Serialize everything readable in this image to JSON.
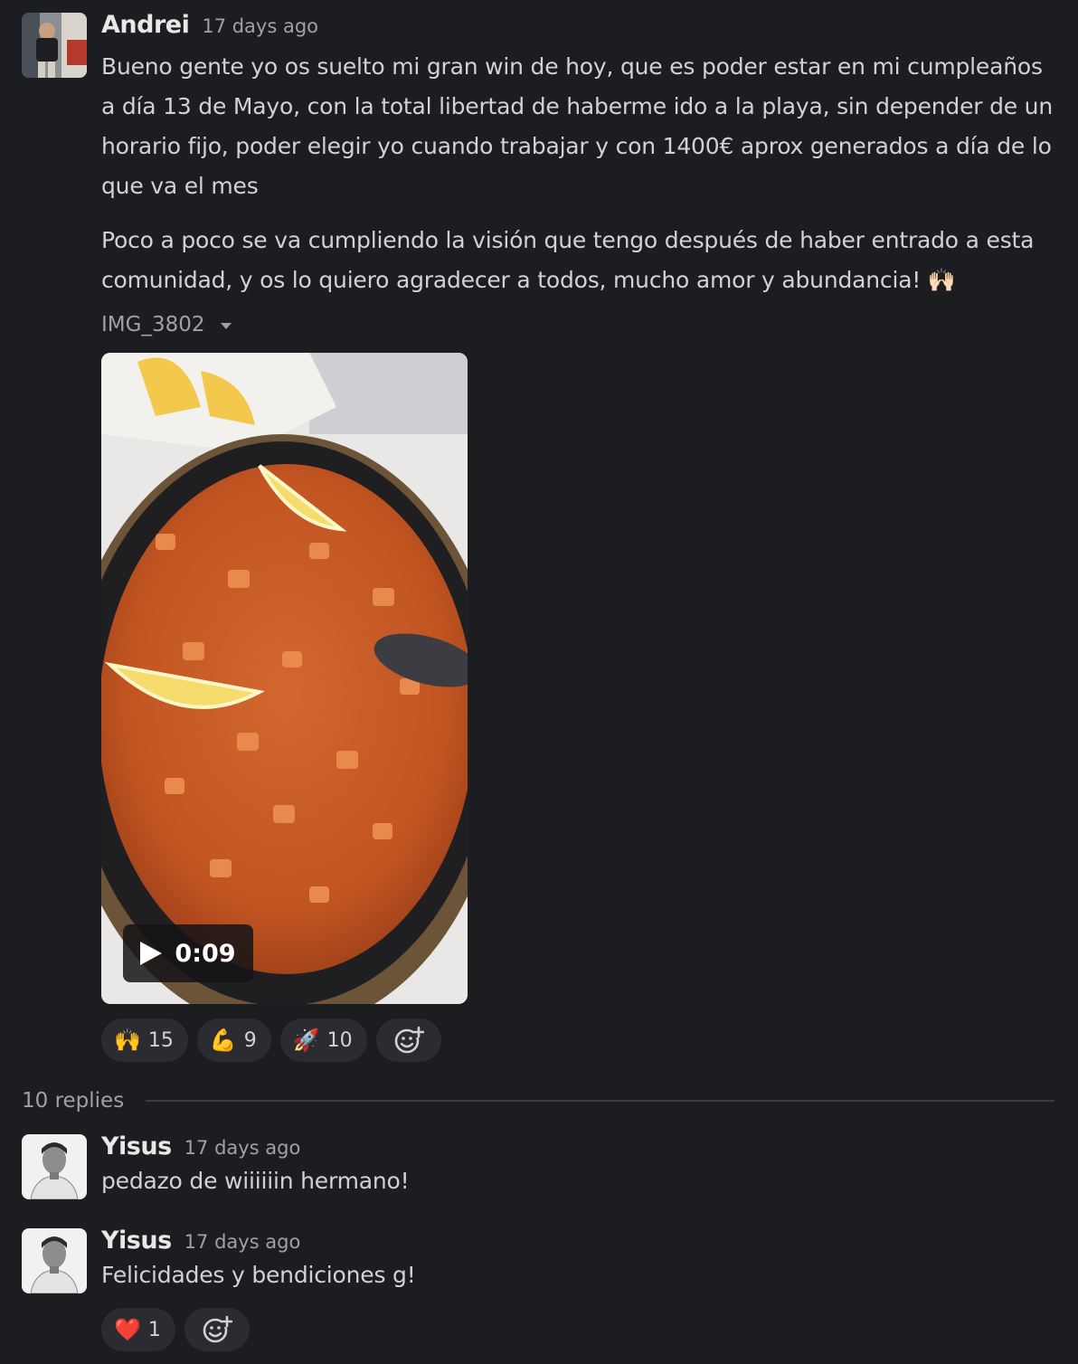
{
  "main_message": {
    "author": "Andrei",
    "timestamp": "17 days ago",
    "paragraph_1": "Bueno gente yo os suelto mi gran win de hoy, que es poder estar en mi cumpleaños a día 13 de Mayo, con la total libertad de haberme ido a la playa, sin depender de un horario fijo, poder elegir yo cuando trabajar y con 1400€ aprox generados a día de lo que va el mes",
    "paragraph_2": "Poco a poco se va cumpliendo la visión que tengo después de haber entrado a esta comunidad, y os lo quiero agradecer a todos, mucho amor y abundancia! 🙌🏻",
    "file_name": "IMG_3802",
    "video_duration": "0:09",
    "reactions": [
      {
        "emoji": "🙌",
        "count": "15"
      },
      {
        "emoji": "💪",
        "count": "9"
      },
      {
        "emoji": "🚀",
        "count": "10"
      }
    ]
  },
  "thread": {
    "replies_label": "10 replies"
  },
  "replies": [
    {
      "author": "Yisus",
      "timestamp": "17 days ago",
      "text": "pedazo de wiiiiiin hermano!"
    },
    {
      "author": "Yisus",
      "timestamp": "17 days ago",
      "text": "Felicidades y bendiciones g!",
      "reactions": [
        {
          "emoji": "❤️",
          "count": "1"
        }
      ]
    }
  ],
  "colors": {
    "background": "#1b1d21",
    "text": "#d1d2d3",
    "muted": "#a0a1a3",
    "reaction_pill": "#2a2c31"
  }
}
